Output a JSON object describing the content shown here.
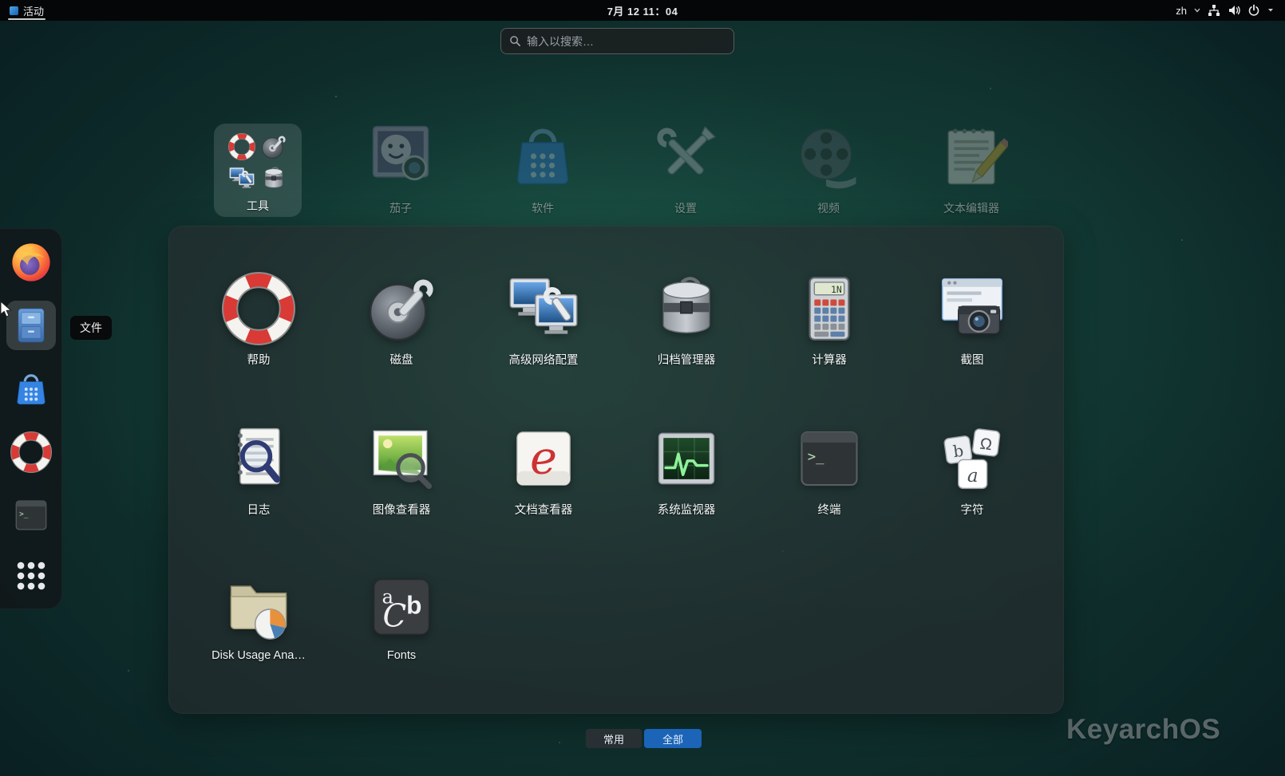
{
  "topbar": {
    "activities_label": "活动",
    "clock": "7月 12 11：04",
    "language": "zh"
  },
  "search": {
    "placeholder": "输入以搜索…"
  },
  "app_grid": {
    "folder_label": "工具",
    "background_apps": [
      {
        "label": "茄子"
      },
      {
        "label": "软件"
      },
      {
        "label": "设置"
      },
      {
        "label": "视频"
      },
      {
        "label": "文本编辑器"
      }
    ]
  },
  "folder_popup": {
    "apps": [
      {
        "label": "帮助"
      },
      {
        "label": "磁盘"
      },
      {
        "label": "高级网络配置"
      },
      {
        "label": "归档管理器"
      },
      {
        "label": "计算器"
      },
      {
        "label": "截图"
      },
      {
        "label": "日志"
      },
      {
        "label": "图像查看器"
      },
      {
        "label": "文档查看器"
      },
      {
        "label": "系统监视器"
      },
      {
        "label": "终端"
      },
      {
        "label": "字符"
      },
      {
        "label": "Disk Usage Ana…"
      },
      {
        "label": "Fonts"
      }
    ]
  },
  "dock": {
    "tooltip": "文件"
  },
  "pager": {
    "frequent_label": "常用",
    "all_label": "全部"
  },
  "watermark": "KeyarchOS",
  "colors": {
    "accent_blue": "#1b64b8",
    "folder_selection": "rgba(255,255,255,0.13)"
  }
}
